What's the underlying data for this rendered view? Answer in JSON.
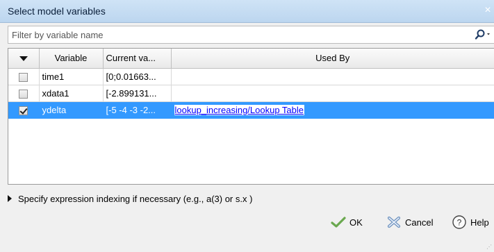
{
  "window": {
    "title": "Select model variables",
    "close": "×"
  },
  "filter": {
    "placeholder": "Filter by variable name",
    "value": ""
  },
  "table": {
    "headers": [
      "",
      "Variable",
      "Current va...",
      "Used By"
    ],
    "rows": [
      {
        "checked": false,
        "variable": "time1",
        "current_value": "[0;0.01663...",
        "used_by": "",
        "selected": false
      },
      {
        "checked": false,
        "variable": "xdata1",
        "current_value": "[-2.899131...",
        "used_by": "",
        "selected": false
      },
      {
        "checked": true,
        "variable": "ydelta",
        "current_value": "[-5 -4 -3 -2...",
        "used_by": "lookup_increasing/Lookup Table",
        "selected": true
      }
    ]
  },
  "indexing": {
    "label": "Specify expression indexing if necessary (e.g., a(3) or s.x )"
  },
  "buttons": {
    "ok": "OK",
    "cancel": "Cancel",
    "help": "Help"
  },
  "colors": {
    "selection": "#3399ff",
    "link": "#0000ff",
    "titlebar": "#c4dbf2"
  }
}
